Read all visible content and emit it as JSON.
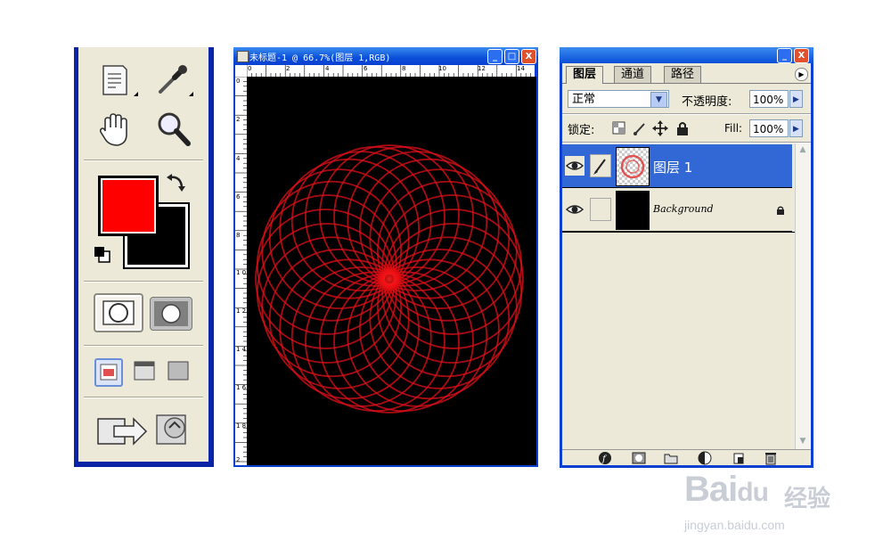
{
  "document": {
    "title": "未标题-1 @ 66.7%(图层 1,RGB)",
    "ruler_top": [
      "0",
      "2",
      "4",
      "6",
      "8",
      "10",
      "12",
      "14"
    ],
    "ruler_left": [
      "0",
      "2",
      "4",
      "6",
      "8",
      "1 0",
      "1 2",
      "1 4",
      "1 6",
      "1 8",
      "2"
    ],
    "minimize_label": "_",
    "maximize_label": "□",
    "close_label": "X"
  },
  "toolbox": {
    "tools": [
      "notes-tool",
      "eyedropper-tool",
      "hand-tool",
      "zoom-tool"
    ],
    "foreground_color": "#ff0000",
    "background_color": "#000000",
    "modes": [
      "standard-mode",
      "quick-mask-mode"
    ],
    "screen_modes": [
      "standard-screen",
      "full-screen-menu",
      "full-screen"
    ],
    "bottom_buttons": [
      "jump-to-imageready",
      "export"
    ]
  },
  "layers_panel": {
    "tabs": [
      "图层",
      "通道",
      "路径"
    ],
    "blend_mode": "正常",
    "opacity_label": "不透明度:",
    "opacity_value": "100%",
    "lock_label": "锁定:",
    "fill_label": "Fill:",
    "fill_value": "100%",
    "layers": [
      {
        "name": "图层 1",
        "selected": true,
        "visible": true
      },
      {
        "name": "Background",
        "selected": false,
        "visible": true,
        "locked": true
      }
    ],
    "bottom_icons": [
      "layer-style",
      "layer-mask",
      "new-group",
      "adjustment-layer",
      "new-layer",
      "delete-layer"
    ]
  },
  "watermark": {
    "brand": "Bai",
    "brand_du": "du",
    "cn": "经验",
    "url": "jingyan.baidu.com"
  },
  "colors": {
    "xp_blue": "#0a3fd2",
    "panel_bg": "#ece9d8",
    "selection": "#3168d6",
    "spiro": "#e0101a"
  }
}
